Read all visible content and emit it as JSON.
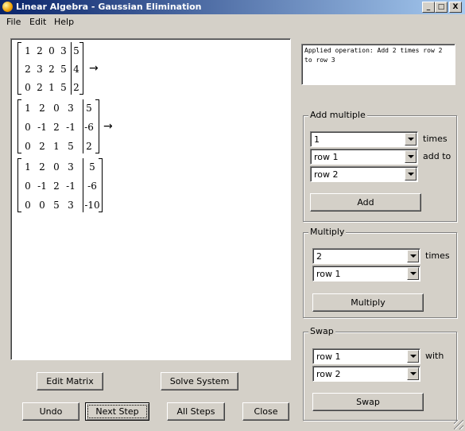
{
  "window": {
    "title": "Linear Algebra - Gaussian Elimination",
    "controls": {
      "minimize": "_",
      "maximize": "□",
      "close": "X"
    }
  },
  "menu": [
    "File",
    "Edit",
    "Help"
  ],
  "matrices": [
    {
      "rows": [
        [
          "1",
          "2",
          "0",
          "3",
          "5"
        ],
        [
          "2",
          "3",
          "2",
          "5",
          "4"
        ],
        [
          "0",
          "2",
          "1",
          "5",
          "2"
        ]
      ],
      "arrow": "→"
    },
    {
      "rows": [
        [
          "1",
          "2",
          "0",
          "3",
          "5"
        ],
        [
          "0",
          "-1",
          "2",
          "-1",
          "-6"
        ],
        [
          "0",
          "2",
          "1",
          "5",
          "2"
        ]
      ],
      "arrow": "→"
    },
    {
      "rows": [
        [
          "1",
          "2",
          "0",
          "3",
          "5"
        ],
        [
          "0",
          "-1",
          "2",
          "-1",
          "-6"
        ],
        [
          "0",
          "0",
          "5",
          "3",
          "-10"
        ]
      ],
      "arrow": ""
    }
  ],
  "log": {
    "text": "Applied operation:  Add 2 times row 2 to row 3"
  },
  "add_multiple": {
    "title": "Add multiple",
    "factor": "1",
    "times_label": "times",
    "source": "row 1",
    "add_to_label": "add to",
    "target": "row 2",
    "button": "Add"
  },
  "multiply": {
    "title": "Multiply",
    "factor": "2",
    "times_label": "times",
    "row": "row 1",
    "button": "Multiply"
  },
  "swap": {
    "title": "Swap",
    "row_a": "row 1",
    "with_label": "with",
    "row_b": "row 2",
    "button": "Swap"
  },
  "buttons": {
    "edit_matrix": "Edit Matrix",
    "solve_system": "Solve System",
    "undo": "Undo",
    "next_step": "Next Step",
    "all_steps": "All Steps",
    "close": "Close"
  }
}
